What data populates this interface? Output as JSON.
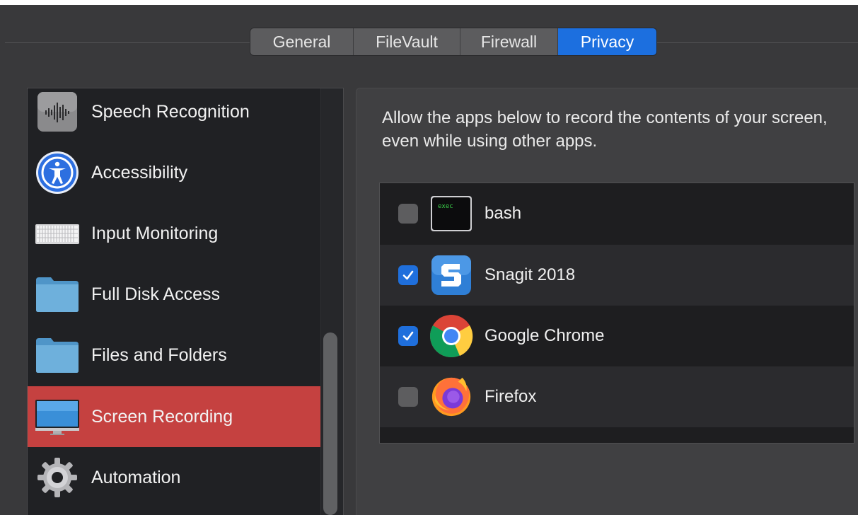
{
  "tabs": [
    {
      "label": "General",
      "active": false
    },
    {
      "label": "FileVault",
      "active": false
    },
    {
      "label": "Firewall",
      "active": false
    },
    {
      "label": "Privacy",
      "active": true
    }
  ],
  "sidebar": {
    "items": [
      {
        "label": "Speech Recognition",
        "icon": "waveform-icon",
        "selected": false
      },
      {
        "label": "Accessibility",
        "icon": "accessibility-icon",
        "selected": false
      },
      {
        "label": "Input Monitoring",
        "icon": "keyboard-icon",
        "selected": false
      },
      {
        "label": "Full Disk Access",
        "icon": "folder-icon",
        "selected": false
      },
      {
        "label": "Files and Folders",
        "icon": "folder-icon",
        "selected": false
      },
      {
        "label": "Screen Recording",
        "icon": "display-icon",
        "selected": true
      },
      {
        "label": "Automation",
        "icon": "gear-icon",
        "selected": false
      }
    ]
  },
  "content": {
    "description": "Allow the apps below to record the contents of your screen, even while using other apps.",
    "apps": [
      {
        "name": "bash",
        "checked": false,
        "icon": "terminal-icon",
        "icon_text": "exec"
      },
      {
        "name": "Snagit 2018",
        "checked": true,
        "icon": "snagit-icon"
      },
      {
        "name": "Google Chrome",
        "checked": true,
        "icon": "chrome-icon"
      },
      {
        "name": "Firefox",
        "checked": false,
        "icon": "firefox-icon"
      }
    ]
  },
  "colors": {
    "accent": "#1c6fdf",
    "selection": "#c54140"
  }
}
